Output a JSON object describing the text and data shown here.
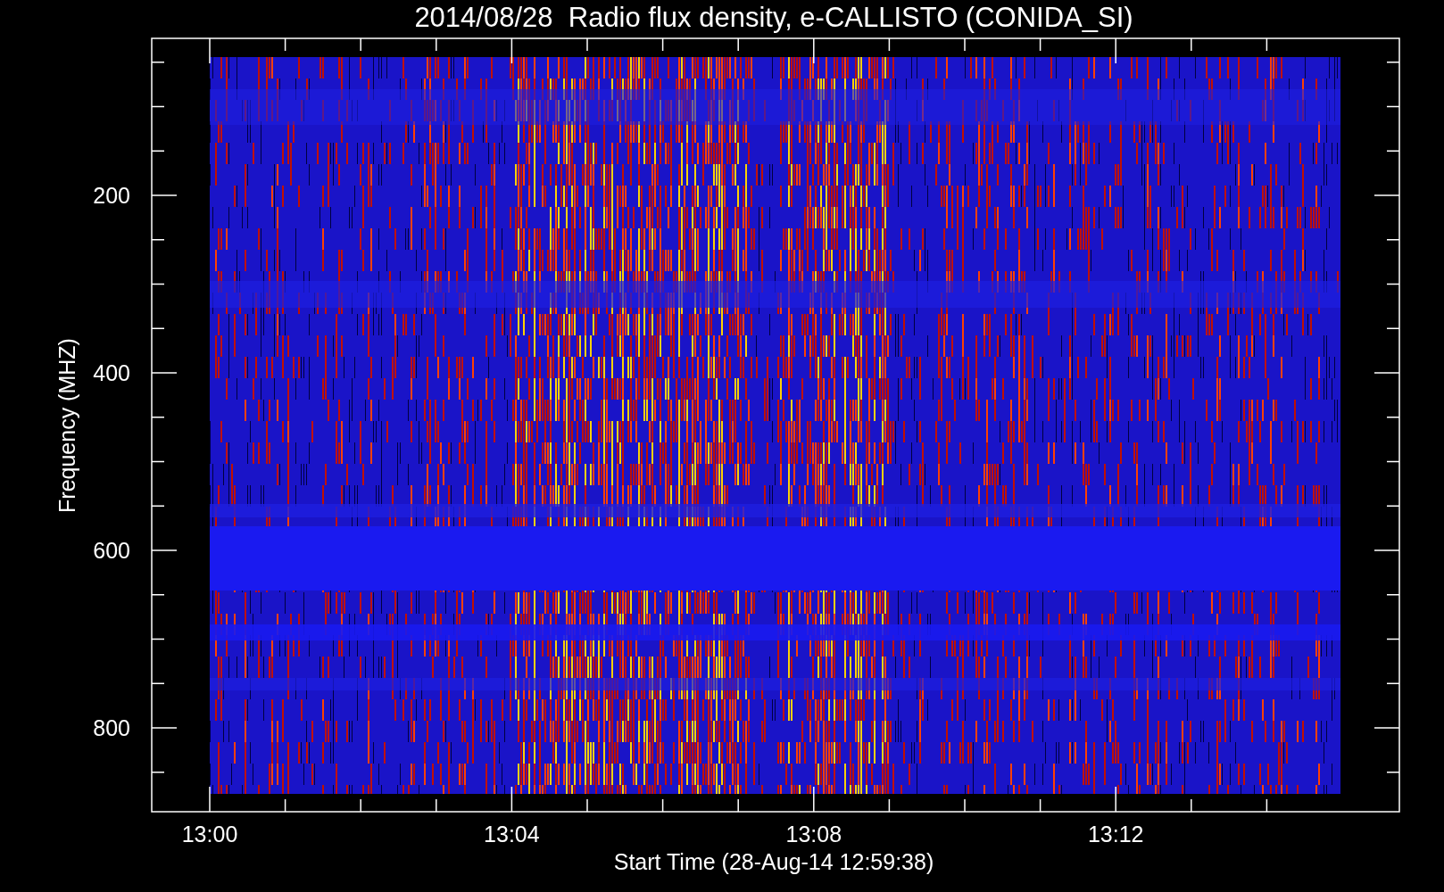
{
  "title": "2014/08/28  Radio flux density, e-CALLISTO (CONIDA_SI)",
  "y_axis": {
    "label": "Frequency (MHZ)",
    "ticks": [
      "200",
      "400",
      "600",
      "800"
    ]
  },
  "x_axis": {
    "label": "Start Time (28-Aug-14 12:59:38)",
    "ticks": [
      "13:00",
      "13:04",
      "13:08",
      "13:12"
    ]
  }
}
